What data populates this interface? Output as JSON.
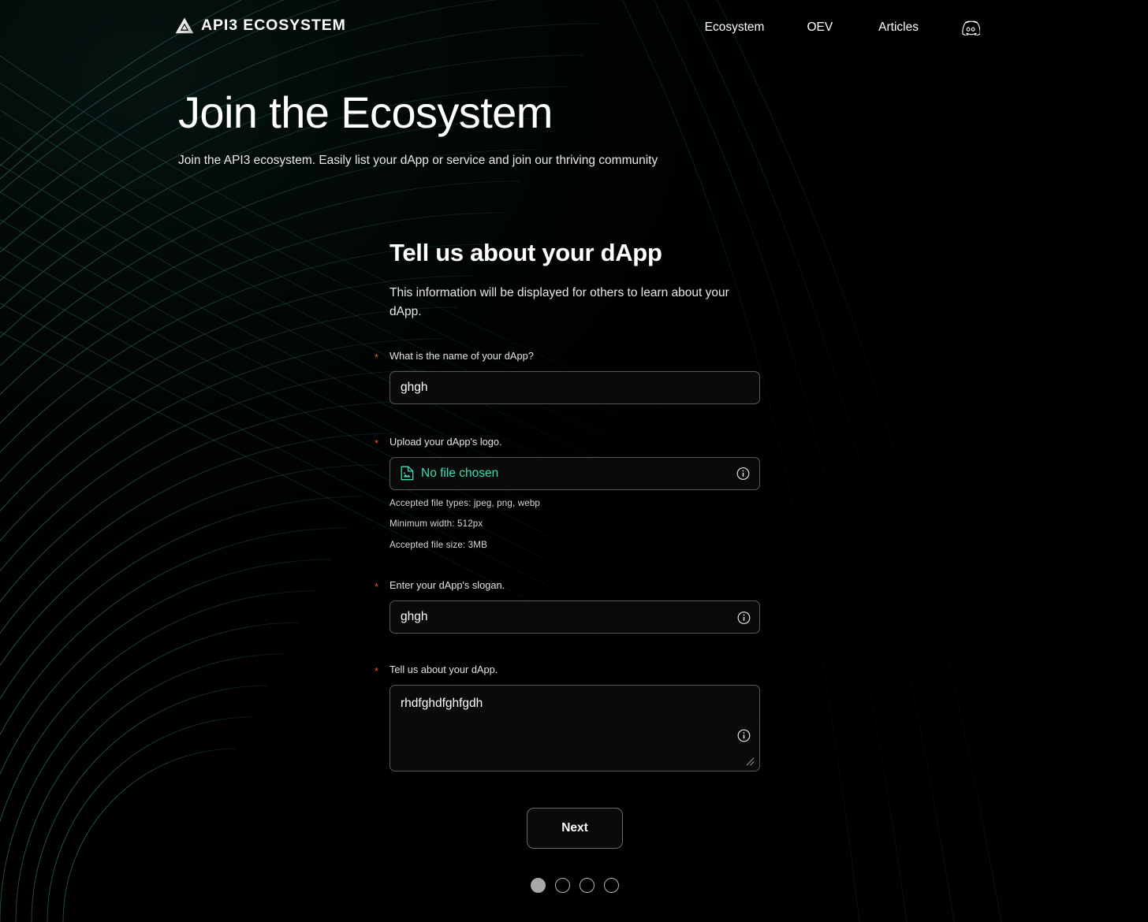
{
  "brand": {
    "mark_icon": "api3-triangle-logo-icon",
    "name_primary": "API3",
    "name_secondary": "ECOSYSTEM"
  },
  "nav": {
    "items": [
      {
        "label": "Ecosystem"
      },
      {
        "label": "OEV"
      },
      {
        "label": "Articles"
      }
    ],
    "discord_icon": "discord-icon"
  },
  "hero": {
    "title": "Join the Ecosystem",
    "subtitle": "Join the API3 ecosystem. Easily list your dApp or service and join our thriving community"
  },
  "form": {
    "title": "Tell us about your dApp",
    "description": "This information will be displayed for others to learn about your dApp.",
    "required_marker": "*",
    "fields": {
      "name": {
        "label": "What is the name of your dApp?",
        "value": "ghgh",
        "placeholder": ""
      },
      "logo": {
        "label": "Upload your dApp's logo.",
        "file_status": "No file chosen",
        "file_icon": "image-file-icon",
        "info_icon": "info-circle-icon",
        "hints": [
          "Accepted file types: jpeg, png, webp",
          "Minimum width: 512px",
          "Accepted file size: 3MB"
        ]
      },
      "slogan": {
        "label": "Enter your dApp's slogan.",
        "value": "ghgh",
        "placeholder": "",
        "info_icon": "info-circle-icon"
      },
      "about": {
        "label": "Tell us about your dApp.",
        "value": "rhdfghdfghfgdh",
        "placeholder": "",
        "info_icon": "info-circle-icon"
      }
    },
    "next_label": "Next",
    "steps": {
      "total": 4,
      "active_index": 0
    }
  },
  "colors": {
    "background": "#000000",
    "accent_teal": "#3ddcb4",
    "required_orange": "#e8572a",
    "border_gray": "#585858",
    "arc_line": "#2e6a5c"
  }
}
